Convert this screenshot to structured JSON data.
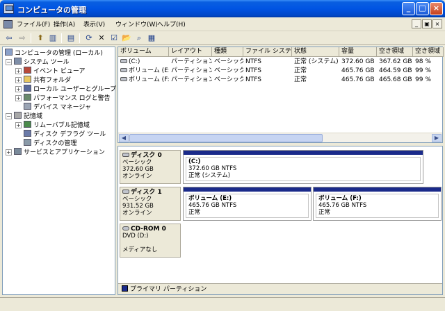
{
  "window": {
    "title": "コンピュータの管理",
    "minimize": "_",
    "maximize": "□",
    "close": "×"
  },
  "menu": [
    "ファイル(F)",
    "操作(A)",
    "表示(V)",
    "ウィンドウ(W)",
    "ヘルプ(H)"
  ],
  "mdi_controls": [
    "_",
    "▣",
    "×"
  ],
  "toolbar": {
    "back": "⇦",
    "forward": "⇨",
    "up": "⬆",
    "console": "▥",
    "properties": "▤",
    "help": "?",
    "refresh": "⟳",
    "delete": "✕",
    "prop2": "☑",
    "open": "📂",
    "search": "⌕",
    "export": "▦"
  },
  "tree": {
    "root": "コンピュータの管理 (ローカル)",
    "system_tools": "システム ツール",
    "event_viewer": "イベント ビューア",
    "shared_folders": "共有フォルダ",
    "local_users": "ローカル ユーザーとグループ",
    "performance": "パフォーマンス ログと警告",
    "device_manager": "デバイス マネージャ",
    "storage": "記憶域",
    "removable": "リムーバブル記憶域",
    "defrag": "ディスク デフラグ ツール",
    "disk_mgmt": "ディスクの管理",
    "services": "サービスとアプリケーション"
  },
  "volume_list": {
    "columns": [
      "ボリューム",
      "レイアウト",
      "種類",
      "ファイル システム",
      "状態",
      "容量",
      "空き領域",
      "空き領域"
    ],
    "rows": [
      [
        "(C:)",
        "パーティション",
        "ベーシック",
        "NTFS",
        "正常 (システム)",
        "372.60 GB",
        "367.62 GB",
        "98 %"
      ],
      [
        "ボリューム (E:)",
        "パーティション",
        "ベーシック",
        "NTFS",
        "正常",
        "465.76 GB",
        "464.59 GB",
        "99 %"
      ],
      [
        "ボリューム (F:)",
        "パーティション",
        "ベーシック",
        "NTFS",
        "正常",
        "465.76 GB",
        "465.68 GB",
        "99 %"
      ]
    ]
  },
  "disks": [
    {
      "name": "ディスク 0",
      "type": "ベーシック",
      "size": "372.60 GB",
      "status": "オンライン",
      "volumes": [
        {
          "name": "(C:)",
          "size": "372.60 GB NTFS",
          "status": "正常 (システム)"
        }
      ]
    },
    {
      "name": "ディスク 1",
      "type": "ベーシック",
      "size": "931.52 GB",
      "status": "オンライン",
      "volumes": [
        {
          "name": "ボリューム  (E:)",
          "size": "465.76 GB NTFS",
          "status": "正常"
        },
        {
          "name": "ボリューム  (F:)",
          "size": "465.76 GB NTFS",
          "status": "正常"
        }
      ]
    },
    {
      "name": "CD-ROM 0",
      "type": "DVD (D:)",
      "media": "メディアなし"
    }
  ],
  "legend": {
    "label": "プライマリ パーティション",
    "color": "#1a2a8a"
  },
  "colors": {
    "title_bar": "#0054e3",
    "partition_bar": "#1a2a8a"
  }
}
